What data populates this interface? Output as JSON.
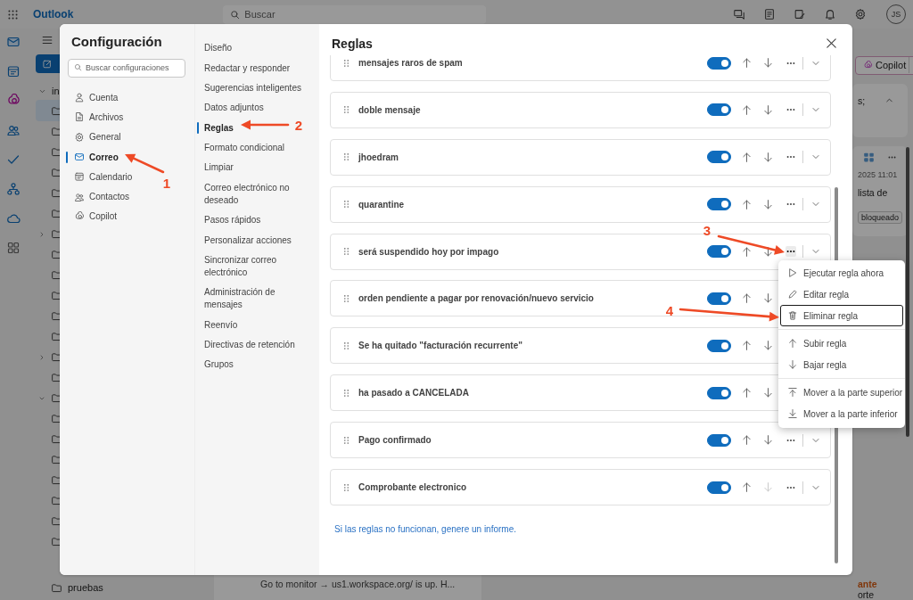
{
  "app": {
    "name": "Outlook",
    "search_placeholder": "Buscar",
    "avatar": "JS"
  },
  "rail": [
    {
      "selected": true
    },
    {
      "selected": false
    },
    {
      "selected": false
    },
    {
      "selected": false
    },
    {
      "selected": false
    },
    {
      "selected": false
    },
    {
      "selected": false
    },
    {
      "selected": false
    }
  ],
  "folders": {
    "top_label": "in",
    "bottom_label": "pruebas"
  },
  "message_preview": "Go to monitor → us1.workspace.org/ is up. H...",
  "reading_pane": {
    "copilot_button": "Copilot",
    "fragment": "s;",
    "date": "2025 11:01",
    "snippet": "lista de",
    "tag": "bloqueado",
    "highlight": "ante",
    "text": "orte"
  },
  "settings": {
    "title": "Configuración",
    "search_placeholder": "Buscar configuraciones",
    "categories": [
      {
        "label": "Cuenta",
        "selected": false
      },
      {
        "label": "Archivos",
        "selected": false
      },
      {
        "label": "General",
        "selected": false
      },
      {
        "label": "Correo",
        "selected": true
      },
      {
        "label": "Calendario",
        "selected": false
      },
      {
        "label": "Contactos",
        "selected": false
      },
      {
        "label": "Copilot",
        "selected": false
      }
    ],
    "sections": [
      {
        "label": "Diseño",
        "selected": false
      },
      {
        "label": "Redactar y responder",
        "selected": false
      },
      {
        "label": "Sugerencias inteligentes",
        "selected": false
      },
      {
        "label": "Datos adjuntos",
        "selected": false
      },
      {
        "label": "Reglas",
        "selected": true
      },
      {
        "label": "Formato condicional",
        "selected": false
      },
      {
        "label": "Limpiar",
        "selected": false
      },
      {
        "label": "Correo electrónico no deseado",
        "selected": false
      },
      {
        "label": "Pasos rápidos",
        "selected": false
      },
      {
        "label": "Personalizar acciones",
        "selected": false
      },
      {
        "label": "Sincronizar correo electrónico",
        "selected": false
      },
      {
        "label": "Administración de mensajes",
        "selected": false
      },
      {
        "label": "Reenvío",
        "selected": false
      },
      {
        "label": "Directivas de retención",
        "selected": false
      },
      {
        "label": "Grupos",
        "selected": false
      }
    ]
  },
  "rules_pane": {
    "title": "Reglas",
    "rules": [
      {
        "name": "mensajes raros de spam",
        "enabled": true,
        "down_disabled": false
      },
      {
        "name": "doble mensaje",
        "enabled": true,
        "down_disabled": false
      },
      {
        "name": "jhoedram",
        "enabled": true,
        "down_disabled": false
      },
      {
        "name": "quarantine",
        "enabled": true,
        "down_disabled": false
      },
      {
        "name": "será suspendido hoy por impago",
        "enabled": true,
        "down_disabled": false,
        "menu_open": true
      },
      {
        "name": "orden pendiente a pagar por renovación/nuevo servicio",
        "enabled": true,
        "down_disabled": false
      },
      {
        "name": "Se ha quitado \"facturación recurrente\"",
        "enabled": true,
        "down_disabled": false
      },
      {
        "name": "ha pasado a CANCELADA",
        "enabled": true,
        "down_disabled": false
      },
      {
        "name": "Pago confirmado",
        "enabled": true,
        "down_disabled": false
      },
      {
        "name": "Comprobante electronico",
        "enabled": true,
        "down_disabled": true
      }
    ],
    "link": "Si las reglas no funcionan, genere un informe."
  },
  "context_menu": {
    "groups": [
      {
        "items": [
          {
            "label": "Ejecutar regla ahora",
            "focused": false
          },
          {
            "label": "Editar regla",
            "focused": false
          },
          {
            "label": "Eliminar regla",
            "focused": true
          }
        ]
      },
      {
        "items": [
          {
            "label": "Subir regla",
            "focused": false
          },
          {
            "label": "Bajar regla",
            "focused": false
          }
        ]
      },
      {
        "items": [
          {
            "label": "Mover a la parte superior",
            "focused": false
          },
          {
            "label": "Mover a la parte inferior",
            "focused": false
          }
        ]
      }
    ]
  },
  "annotations": [
    {
      "label": "1"
    },
    {
      "label": "2"
    },
    {
      "label": "3"
    },
    {
      "label": "4"
    }
  ]
}
